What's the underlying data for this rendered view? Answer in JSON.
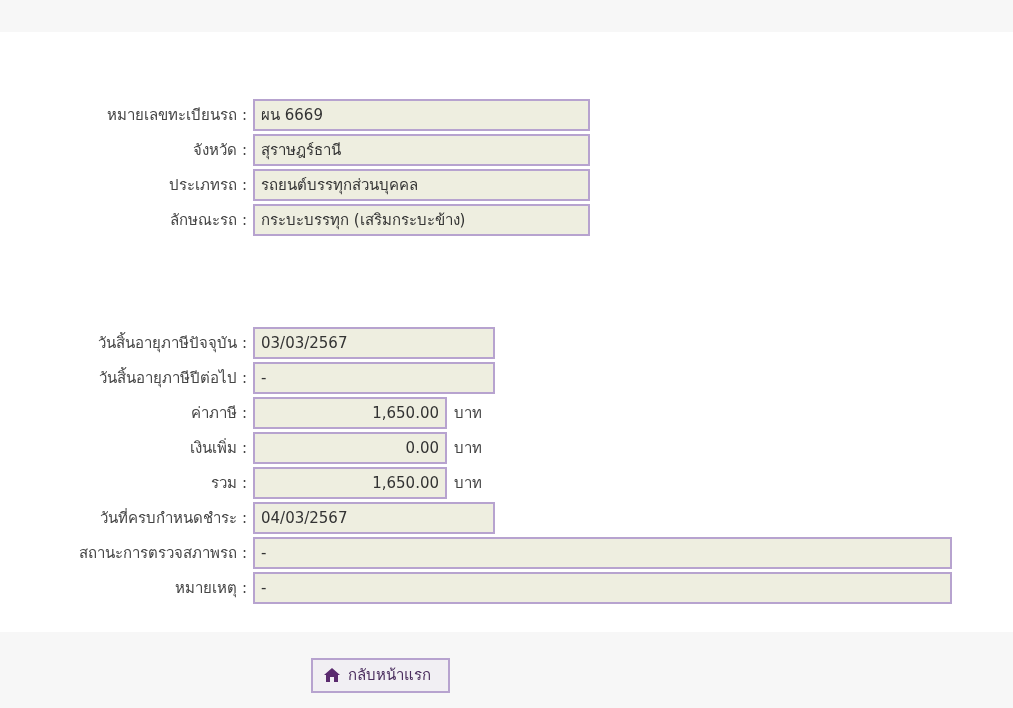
{
  "vehicle": [
    {
      "label": "หมายเลขทะเบียนรถ :",
      "value": "ผน 6669",
      "kind": "wide"
    },
    {
      "label": "จังหวัด :",
      "value": "สุราษฎร์ธานี",
      "kind": "wide"
    },
    {
      "label": "ประเภทรถ :",
      "value": "รถยนต์บรรทุกส่วนบุคคล",
      "kind": "wide"
    },
    {
      "label": "ลักษณะรถ :",
      "value": "กระบะบรรทุก (เสริมกระบะข้าง)",
      "kind": "wide"
    }
  ],
  "tax": [
    {
      "label": "วันสิ้นอายุภาษีปัจจุบัน :",
      "value": "03/03/2567",
      "kind": "date"
    },
    {
      "label": "วันสิ้นอายุภาษีปีต่อไป :",
      "value": "-",
      "kind": "date"
    },
    {
      "label": "ค่าภาษี :",
      "value": "1,650.00",
      "kind": "amount",
      "unit": "บาท"
    },
    {
      "label": "เงินเพิ่ม :",
      "value": "0.00",
      "kind": "amount",
      "unit": "บาท"
    },
    {
      "label": "รวม :",
      "value": "1,650.00",
      "kind": "amount",
      "unit": "บาท"
    },
    {
      "label": "วันที่ครบกำหนดชำระ :",
      "value": "04/03/2567",
      "kind": "date"
    },
    {
      "label": "สถานะการตรวจสภาพรถ :",
      "value": "-",
      "kind": "full"
    },
    {
      "label": "หมายเหตุ :",
      "value": "-",
      "kind": "full"
    }
  ],
  "home_button": {
    "label": "กลับหน้าแรก"
  }
}
